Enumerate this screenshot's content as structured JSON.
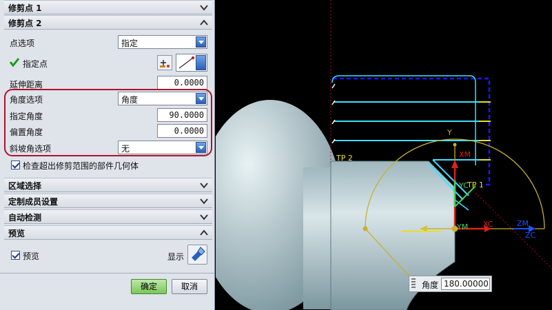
{
  "sections": {
    "trim_point_1": {
      "title": "修剪点 1"
    },
    "trim_point_2": {
      "title": "修剪点 2"
    },
    "region_select": {
      "title": "区域选择"
    },
    "custom_members": {
      "title": "定制成员设置"
    },
    "auto_detect": {
      "title": "自动检测"
    },
    "preview": {
      "title": "预览"
    }
  },
  "trim_point_2": {
    "point_option_label": "点选项",
    "point_option_value": "指定",
    "specify_point_label": "指定点",
    "extend_distance_label": "延伸距离",
    "extend_distance_value": "0.0000",
    "angle_option_label": "角度选项",
    "angle_option_value": "角度",
    "specify_angle_label": "指定角度",
    "specify_angle_value": "90.0000",
    "offset_angle_label": "偏置角度",
    "offset_angle_value": "0.0000",
    "slope_option_label": "斜坡角选项",
    "slope_option_value": "无",
    "check_overrun_label": "检查超出修剪范围的部件几何体",
    "check_overrun_checked": true
  },
  "preview": {
    "preview_label": "预览",
    "preview_checked": true,
    "show_label": "显示"
  },
  "buttons": {
    "ok": "确定",
    "cancel": "取消"
  },
  "viewport": {
    "labels": {
      "tp2": "TP 2",
      "tp1": "TP 1",
      "xm": "XM",
      "ym": "YM",
      "yc": "YC",
      "xc": "XC",
      "zm": "ZM",
      "zc": "ZC"
    },
    "angle_input": {
      "label": "角度",
      "value": "180.00000"
    }
  },
  "colors": {
    "highlight_ring": "#b0102a",
    "check_green": "#1c9a1c",
    "toolpath_blue": "#1a1aff",
    "toolpath_cyan": "#40e0ff",
    "toolpath_yellow": "#e8e020",
    "axis_red": "#e02020",
    "axis_blue": "#2050ff",
    "part_fill": "#bcd0d6"
  }
}
